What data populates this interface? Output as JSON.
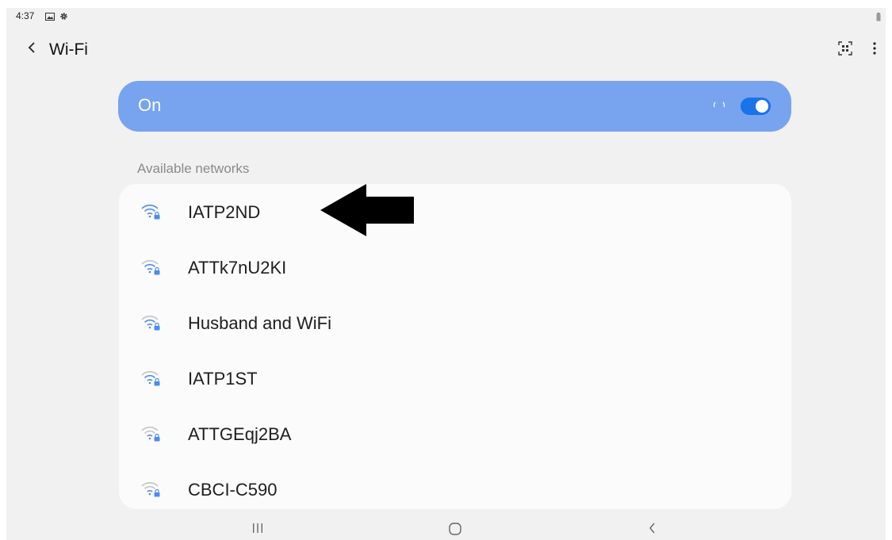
{
  "status_bar": {
    "time": "4:37",
    "icons": [
      "gallery-icon",
      "gear-icon"
    ],
    "right_icons": [
      "battery-icon"
    ]
  },
  "app_bar": {
    "title": "Wi-Fi",
    "icons": [
      "back-arrow-icon",
      "qr-scan-icon",
      "more-vert-icon"
    ]
  },
  "toggle": {
    "label": "On",
    "state": "on",
    "colors": {
      "card": "#77a3ef",
      "switch": "#1a73e8"
    }
  },
  "section": {
    "header": "Available networks"
  },
  "networks": [
    {
      "name": "IATP2ND",
      "icon": "wifi-lock-icon",
      "signal": "strong"
    },
    {
      "name": "ATTk7nU2KI",
      "icon": "wifi-lock-icon",
      "signal": "weak"
    },
    {
      "name": "Husband and WiFi",
      "icon": "wifi-lock-icon",
      "signal": "weak"
    },
    {
      "name": "IATP1ST",
      "icon": "wifi-lock-icon",
      "signal": "medium"
    },
    {
      "name": "ATTGEqj2BA",
      "icon": "wifi-lock-icon",
      "signal": "weak"
    },
    {
      "name": "CBCI-C590",
      "icon": "wifi-lock-icon",
      "signal": "weak"
    }
  ],
  "annotation": {
    "icon": "left-arrow-icon",
    "color": "#000000"
  },
  "nav_bar": {
    "icons": [
      "recents-icon",
      "home-icon",
      "back-icon"
    ]
  }
}
